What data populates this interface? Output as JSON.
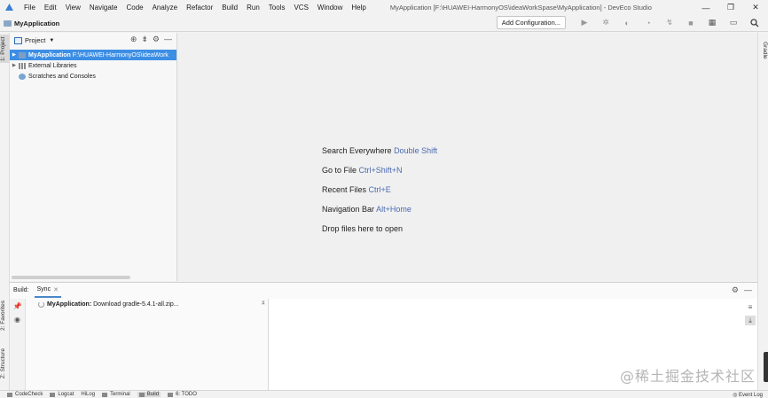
{
  "menubar": {
    "items": [
      "File",
      "Edit",
      "View",
      "Navigate",
      "Code",
      "Analyze",
      "Refactor",
      "Build",
      "Run",
      "Tools",
      "VCS",
      "Window",
      "Help"
    ],
    "window_title": "MyApplication [F:\\HUAWEI-HarmonyOS\\ideaWorkSpase\\MyApplication] - DevEco Studio",
    "controls": [
      "—",
      "❐",
      "✕"
    ]
  },
  "navbar": {
    "breadcrumb": "MyApplication",
    "add_config_label": "Add Configuration..."
  },
  "left_stripe": {
    "project_tab": "1: Project",
    "favorites_tab": "2: Favorites",
    "structure_tab": "Z: Structure"
  },
  "right_stripe": {
    "gradle_tab": "Gradle"
  },
  "project_panel": {
    "title": "Project",
    "tree": [
      {
        "label": "MyApplication",
        "path": "F:\\HUAWEI-HarmonyOS\\ideaWork",
        "selected": true,
        "icon": "module-icon"
      },
      {
        "label": "External Libraries",
        "path": "",
        "selected": false,
        "icon": "library-icon"
      },
      {
        "label": "Scratches and Consoles",
        "path": "",
        "selected": false,
        "icon": "scratches-icon"
      }
    ]
  },
  "editor": {
    "hints": [
      {
        "text": "Search Everywhere",
        "shortcut": "Double Shift"
      },
      {
        "text": "Go to File",
        "shortcut": "Ctrl+Shift+N"
      },
      {
        "text": "Recent Files",
        "shortcut": "Ctrl+E"
      },
      {
        "text": "Navigation Bar",
        "shortcut": "Alt+Home"
      },
      {
        "text": "Drop files here to open",
        "shortcut": ""
      }
    ]
  },
  "build": {
    "label": "Build:",
    "tab": "Sync",
    "row_bold": "MyApplication:",
    "row_text": "Download gradle-5.4.1-all.zip..."
  },
  "statusbar": {
    "items": [
      "CodeCheck",
      "Logcat",
      "HiLog",
      "Terminal",
      "Build",
      "6: TODO"
    ],
    "event_log": "Event Log"
  },
  "watermark": "@稀土掘金技术社区",
  "colors": {
    "selection": "#3c8ee5",
    "shortcut": "#4a6ab0"
  }
}
